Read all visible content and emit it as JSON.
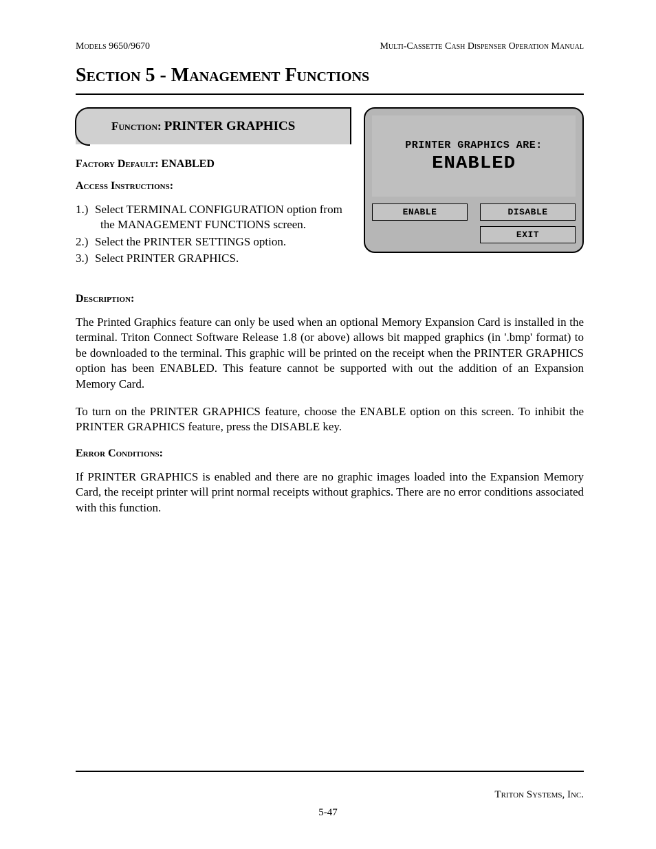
{
  "header": {
    "left": "Models 9650/9670",
    "right": "Multi-Cassette Cash Dispenser Operation Manual"
  },
  "section_title": "Section 5 - Management Functions",
  "function_box": {
    "label": "Function:",
    "value": "PRINTER GRAPHICS"
  },
  "factory_default": {
    "label": "Factory Default:",
    "value": "ENABLED"
  },
  "access_heading": "Access Instructions:",
  "access_steps": [
    {
      "num": "1.)",
      "text": "Select TERMINAL CONFIGURATION option from the MANAGEMENT FUNCTIONS screen."
    },
    {
      "num": "2.)",
      "text": "Select the  PRINTER SETTINGS option."
    },
    {
      "num": "3.)",
      "text": "Select PRINTER GRAPHICS."
    }
  ],
  "terminal": {
    "line1": "PRINTER GRAPHICS ARE:",
    "line2": "ENABLED",
    "buttons": {
      "enable": "ENABLE",
      "disable": "DISABLE",
      "exit": "EXIT"
    }
  },
  "description_heading": "Description:",
  "description_p1": "The Printed Graphics feature can only be used when an optional Memory Expansion Card is installed in the terminal.  Triton Connect Software Release 1.8 (or above) allows bit mapped graphics (in '.bmp' format) to be downloaded to the terminal.  This graphic will be printed on the receipt when the PRINTER GRAPHICS option has been ENABLED. This feature cannot be supported with out the addition of an Expansion Memory Card.",
  "description_p2": "To turn on the PRINTER GRAPHICS feature, choose the ENABLE option on this screen.  To inhibit the PRINTER GRAPHICS feature, press the DISABLE key.",
  "error_heading": "Error Conditions:",
  "error_p1": "If PRINTER GRAPHICS is enabled and there are no graphic images loaded into the Expansion Memory Card, the receipt printer will print normal receipts without graphics.  There are no error conditions associated with this function.",
  "footer": {
    "company": "Triton Systems, Inc.",
    "page": "5-47"
  }
}
